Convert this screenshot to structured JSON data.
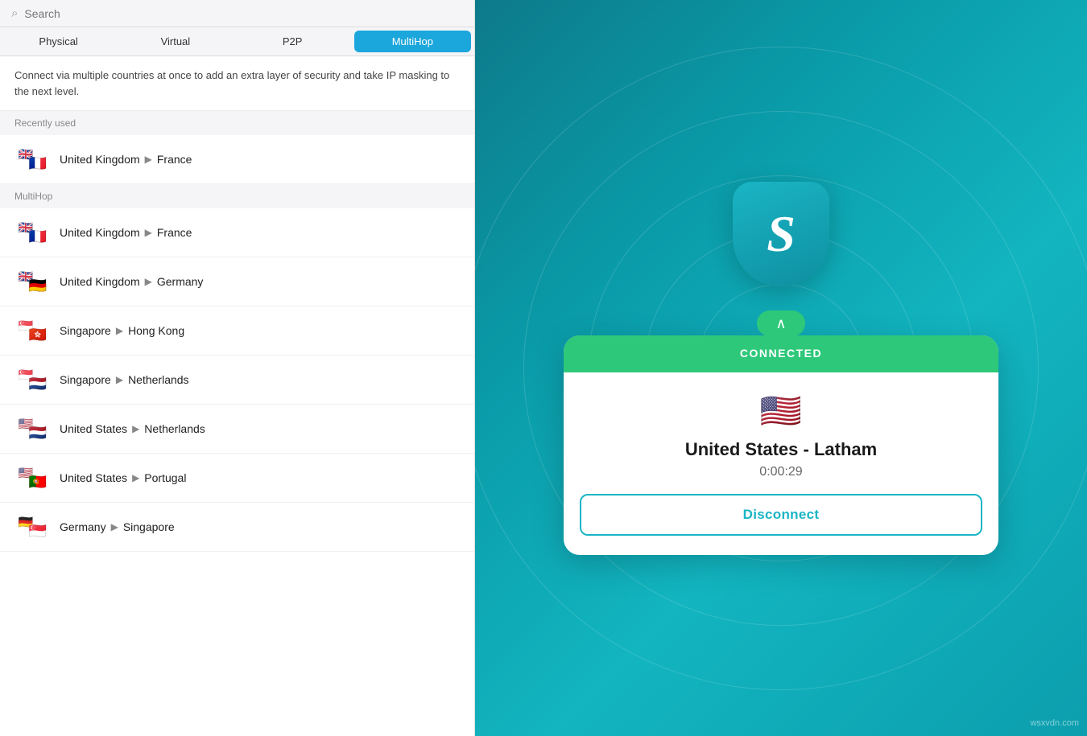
{
  "search": {
    "placeholder": "Search"
  },
  "tabs": [
    {
      "label": "Physical",
      "active": false
    },
    {
      "label": "Virtual",
      "active": false
    },
    {
      "label": "P2P",
      "active": false
    },
    {
      "label": "MultiHop",
      "active": true
    }
  ],
  "description": "Connect via multiple countries at once to add an extra layer of security and take IP masking to the next level.",
  "recently_used_header": "Recently used",
  "multihop_header": "MultiHop",
  "recently_used": [
    {
      "from_flag": "🇬🇧",
      "to_flag": "🇫🇷",
      "from": "United Kingdom",
      "to": "France"
    }
  ],
  "multihop_items": [
    {
      "from_flag": "🇬🇧",
      "to_flag": "🇫🇷",
      "from": "United Kingdom",
      "to": "France"
    },
    {
      "from_flag": "🇬🇧",
      "to_flag": "🇩🇪",
      "from": "United Kingdom",
      "to": "Germany"
    },
    {
      "from_flag": "🇸🇬",
      "to_flag": "🇭🇰",
      "from": "Singapore",
      "to": "Hong Kong"
    },
    {
      "from_flag": "🇸🇬",
      "to_flag": "🇳🇱",
      "from": "Singapore",
      "to": "Netherlands"
    },
    {
      "from_flag": "🇺🇸",
      "to_flag": "🇳🇱",
      "from": "United States",
      "to": "Netherlands"
    },
    {
      "from_flag": "🇺🇸",
      "to_flag": "🇵🇹",
      "from": "United States",
      "to": "Portugal"
    },
    {
      "from_flag": "🇩🇪",
      "to_flag": "🇸🇬",
      "from": "Germany",
      "to": "Singapore"
    }
  ],
  "connected": {
    "status": "CONNECTED",
    "country_flag": "🇺🇸",
    "country_name": "United States - Latham",
    "timer": "0:00:29",
    "disconnect_label": "Disconnect"
  },
  "watermark": "wsxvdn.com"
}
